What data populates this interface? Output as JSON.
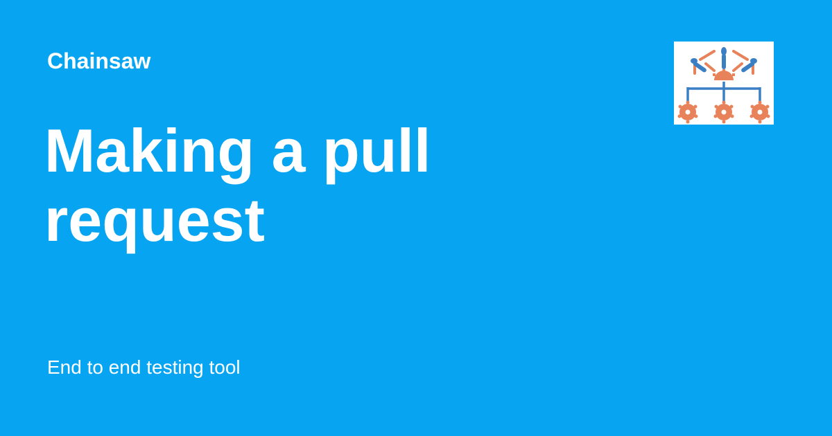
{
  "header": {
    "site_name": "Chainsaw"
  },
  "main": {
    "title": "Making a pull request",
    "tagline": "End to end testing tool"
  },
  "logo": {
    "icon": "chainsaw-logo-icon"
  },
  "colors": {
    "background": "#07a4f2",
    "text": "#ffffff",
    "logo_orange": "#e8825a",
    "logo_blue": "#3a7fc4"
  }
}
